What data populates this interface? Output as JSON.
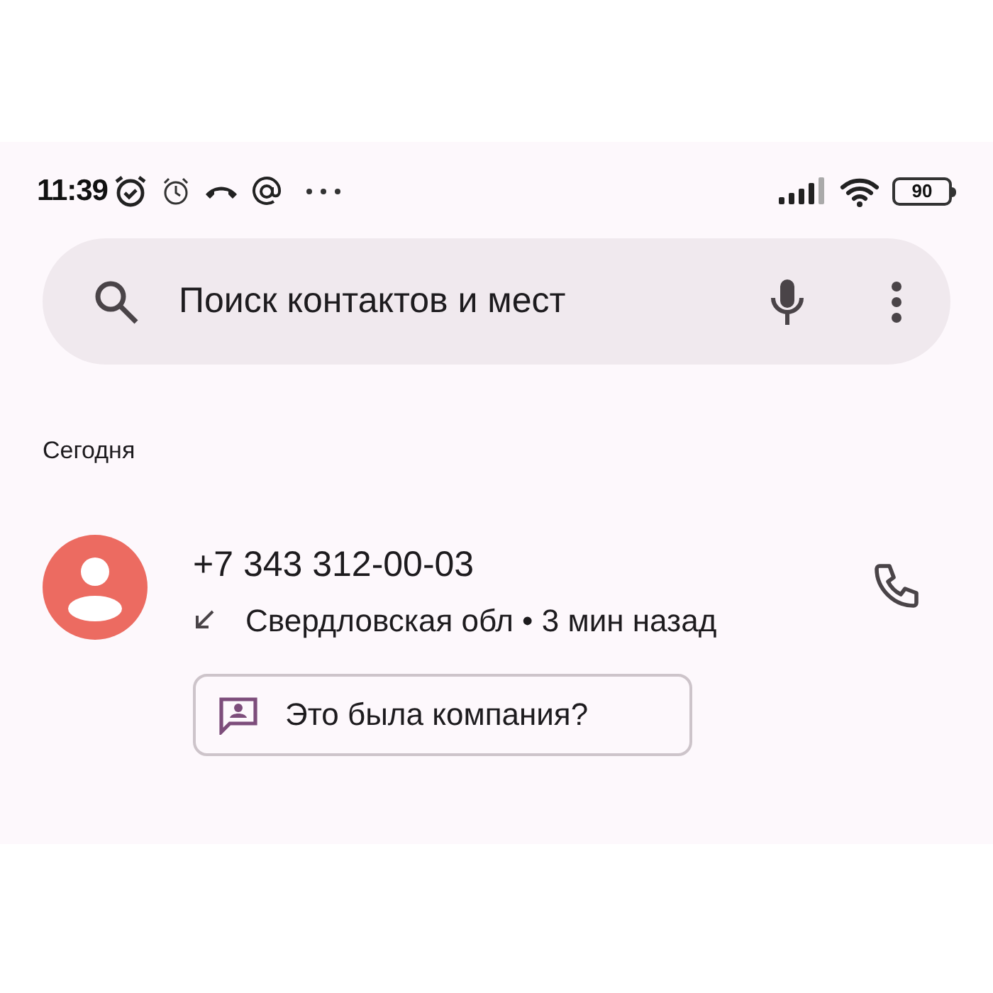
{
  "status_bar": {
    "time": "11:39",
    "battery": "90"
  },
  "search": {
    "placeholder": "Поиск контактов и мест"
  },
  "sections": [
    {
      "title": "Сегодня",
      "calls": [
        {
          "number": "+7 343 312-00-03",
          "kind": "incoming",
          "details": "Свердловская обл • 3 мин назад",
          "action": "Это была компания?"
        }
      ]
    }
  ]
}
